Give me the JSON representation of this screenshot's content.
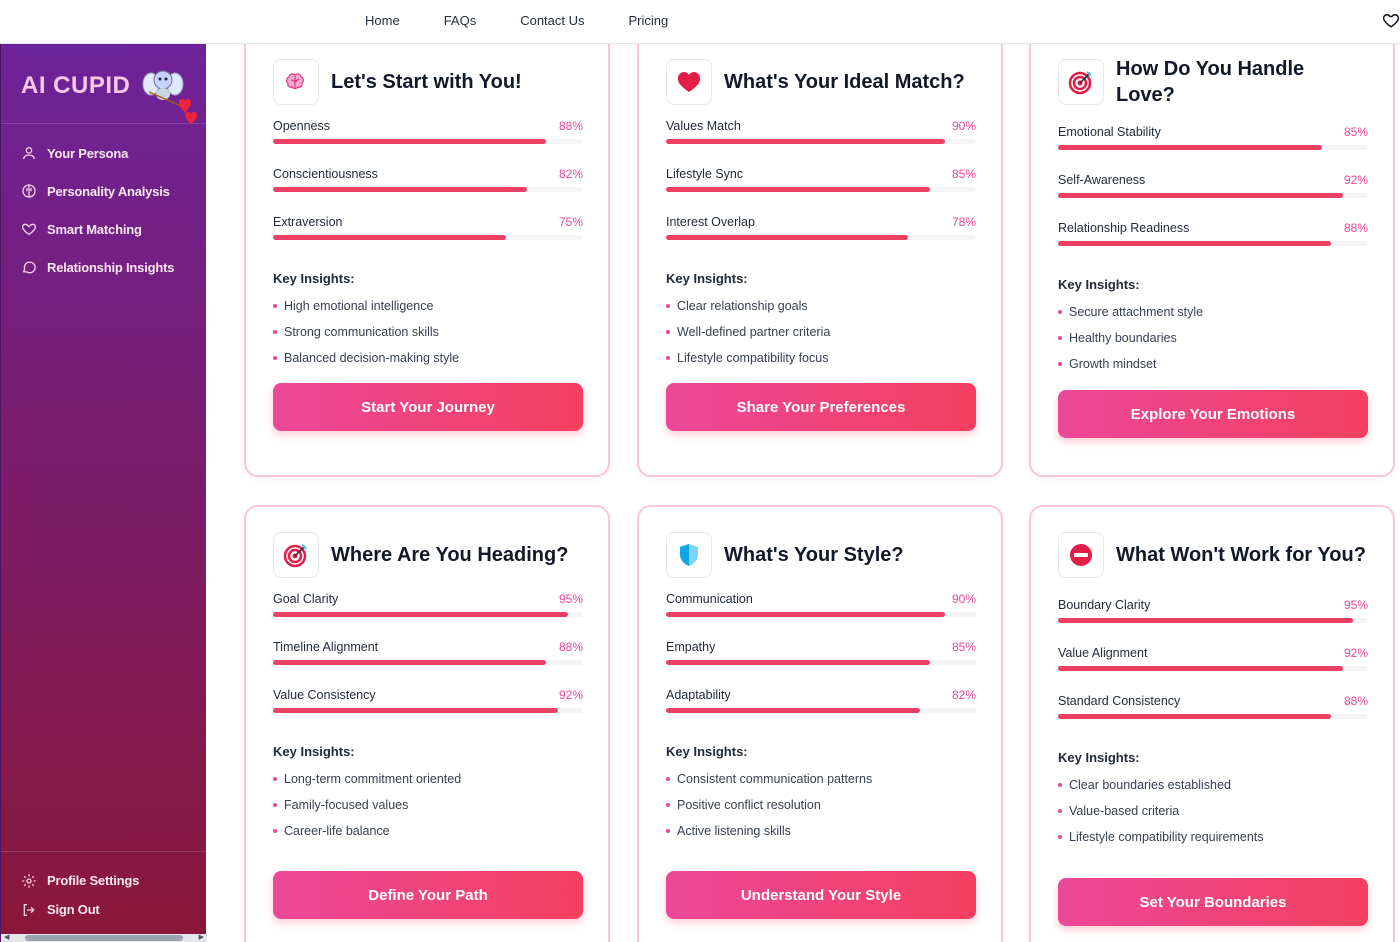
{
  "topnav": {
    "links": [
      "Home",
      "FAQs",
      "Contact Us",
      "Pricing"
    ]
  },
  "sidebar": {
    "logo": "AI CUPID",
    "items": [
      {
        "label": "Your Persona",
        "icon": "user-icon"
      },
      {
        "label": "Personality Analysis",
        "icon": "brain-icon"
      },
      {
        "label": "Smart Matching",
        "icon": "heart-icon"
      },
      {
        "label": "Relationship Insights",
        "icon": "chat-icon"
      }
    ],
    "bottom": [
      {
        "label": "Profile Settings",
        "icon": "gear-icon"
      },
      {
        "label": "Sign Out",
        "icon": "signout-icon"
      }
    ]
  },
  "cards": [
    {
      "title": "Let's Start with You!",
      "icon": "brain-icon",
      "metrics": [
        {
          "label": "Openness",
          "value": 88
        },
        {
          "label": "Conscientiousness",
          "value": 82
        },
        {
          "label": "Extraversion",
          "value": 75
        }
      ],
      "insights_title": "Key Insights:",
      "insights": [
        "High emotional intelligence",
        "Strong communication skills",
        "Balanced decision-making style"
      ],
      "button": "Start Your Journey"
    },
    {
      "title": "What's Your Ideal Match?",
      "icon": "heart-icon",
      "metrics": [
        {
          "label": "Values Match",
          "value": 90
        },
        {
          "label": "Lifestyle Sync",
          "value": 85
        },
        {
          "label": "Interest Overlap",
          "value": 78
        }
      ],
      "insights_title": "Key Insights:",
      "insights": [
        "Clear relationship goals",
        "Well-defined partner criteria",
        "Lifestyle compatibility focus"
      ],
      "button": "Share Your Preferences"
    },
    {
      "title": "How Do You Handle Love?",
      "icon": "target-icon",
      "metrics": [
        {
          "label": "Emotional Stability",
          "value": 85
        },
        {
          "label": "Self-Awareness",
          "value": 92
        },
        {
          "label": "Relationship Readiness",
          "value": 88
        }
      ],
      "insights_title": "Key Insights:",
      "insights": [
        "Secure attachment style",
        "Healthy boundaries",
        "Growth mindset"
      ],
      "button": "Explore Your Emotions"
    },
    {
      "title": "Where Are You Heading?",
      "icon": "target-icon",
      "metrics": [
        {
          "label": "Goal Clarity",
          "value": 95
        },
        {
          "label": "Timeline Alignment",
          "value": 88
        },
        {
          "label": "Value Consistency",
          "value": 92
        }
      ],
      "insights_title": "Key Insights:",
      "insights": [
        "Long-term commitment oriented",
        "Family-focused values",
        "Career-life balance"
      ],
      "button": "Define Your Path"
    },
    {
      "title": "What's Your Style?",
      "icon": "shield-icon",
      "metrics": [
        {
          "label": "Communication",
          "value": 90
        },
        {
          "label": "Empathy",
          "value": 85
        },
        {
          "label": "Adaptability",
          "value": 82
        }
      ],
      "insights_title": "Key Insights:",
      "insights": [
        "Consistent communication patterns",
        "Positive conflict resolution",
        "Active listening skills"
      ],
      "button": "Understand Your Style"
    },
    {
      "title": "What Won't Work for You?",
      "icon": "no-entry-icon",
      "metrics": [
        {
          "label": "Boundary Clarity",
          "value": 95
        },
        {
          "label": "Value Alignment",
          "value": 92
        },
        {
          "label": "Standard Consistency",
          "value": 88
        }
      ],
      "insights_title": "Key Insights:",
      "insights": [
        "Clear boundaries established",
        "Value-based criteria",
        "Lifestyle compatibility requirements"
      ],
      "button": "Set Your Boundaries"
    }
  ],
  "colors": {
    "accent": "#ec4899",
    "bar": "#ec4165",
    "button_start": "#ec4899",
    "button_end": "#f43f5e",
    "sidebar_top": "#6d2399",
    "sidebar_bottom": "#8a1738",
    "card_border": "#f9c5dd"
  }
}
